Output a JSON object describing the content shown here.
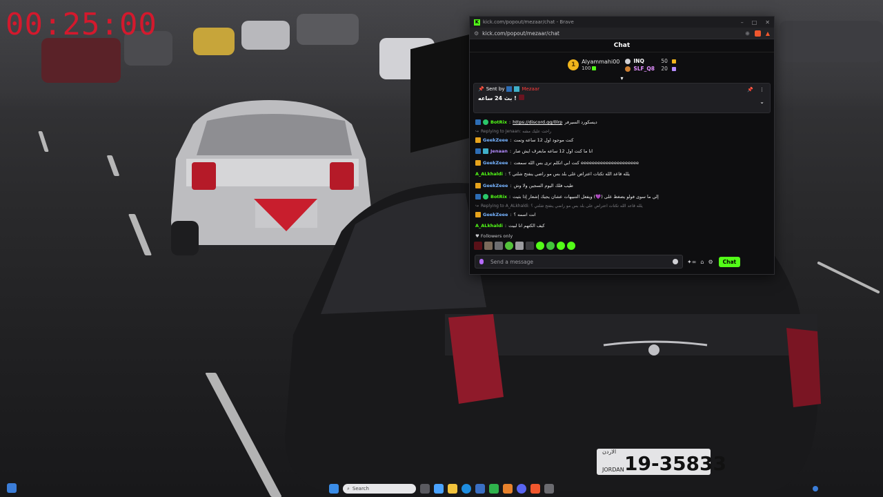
{
  "timer": "00:25:00",
  "browser": {
    "window_title": "kick.com/popout/mezaar/chat - Brave",
    "url": "kick.com/popout/mezaar/chat"
  },
  "chat": {
    "header": "Chat",
    "top_gifters": [
      {
        "rank": "1",
        "name": "Alyammahi00",
        "count": "100"
      },
      {
        "name": "INQ",
        "count": "50"
      },
      {
        "name": "SLF_Q8",
        "count": "20"
      }
    ],
    "pinned": {
      "sent_by_label": "Sent by",
      "sender": "Mezaar",
      "text": "بث 24 ساعه !"
    },
    "messages": [
      {
        "user": "BotRix",
        "text": "ديسكورد السيرفر",
        "link": "https://discord.gg/0lrp"
      },
      {
        "reply_to": "Replying to Jenaan: راحت عليك مشه"
      },
      {
        "user": "GeekZeee",
        "text": "كنت موجود اول 12 ساعه وتمت"
      },
      {
        "user": "Jenaan",
        "text": "انا ما كنت اول 12 ساعه مابعرف ايش صار"
      },
      {
        "user": "GeekZeee",
        "text": "كنت ابي اتكلم ترى بس الله سمعت eeeeeeeeeeeeeeeeeeeee"
      },
      {
        "user": "A_ALkhaldi",
        "text": "يلله قاعد الله تكتات اعتراض على بلد بس مو راضي ينفتح شلتي ؟"
      },
      {
        "user": "GeekZeee",
        "text": "طيب فلك اليوم السجين ولا وش"
      },
      {
        "user": "BotRix",
        "text": "إلي ما سوى فولو يضغط على (💜) ويفعل التنبيهات عشان يجيك إشعار إذا بثيت"
      },
      {
        "reply_to": "Replying to A_ALkhaldi: يلله قاعد الله تكتات اعتراض على بلد بس مو راضي ينفتح شلتي ؟"
      },
      {
        "user": "GeekZeee",
        "text": "انت اسمه ؟"
      },
      {
        "user": "A_ALkhaldi",
        "text": "كيف الكتهم انا لبيت"
      }
    ],
    "followers_only_label": "Followers only",
    "input_placeholder": "Send a message",
    "chat_button": "Chat"
  },
  "taskbar": {
    "search_placeholder": "Search"
  },
  "wallpaper": {
    "license_plate": "19-35833",
    "plate_region": "الاردن",
    "plate_country": "JORDAN"
  },
  "colors": {
    "kick_green": "#53fc18",
    "timer_red": "#e3152b"
  }
}
